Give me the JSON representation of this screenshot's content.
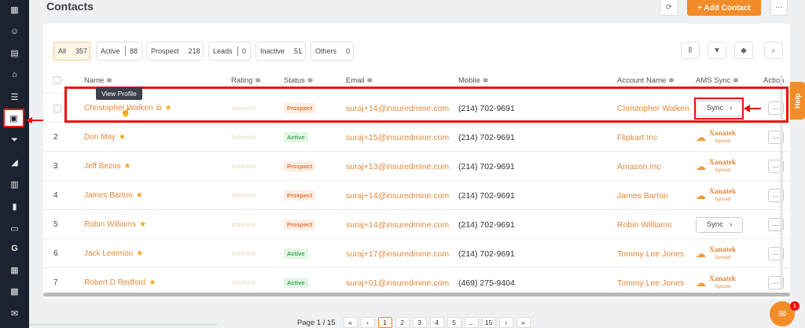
{
  "page": {
    "title": "Contacts"
  },
  "header": {
    "add_contact_label": "+ Add Contact",
    "refresh_icon": "refresh-icon",
    "more_icon": "more-icon"
  },
  "sidebar": {
    "items": [
      "dashboard-icon",
      "contacts-icon",
      "policies-icon",
      "bank-icon",
      "list-icon",
      "contact-card-icon",
      "filter-icon",
      "megaphone-icon",
      "document-icon",
      "reports-icon",
      "folder-icon",
      "google-icon",
      "calculator-icon",
      "calendar-icon",
      "mail-icon"
    ]
  },
  "filters": [
    {
      "label": "All",
      "count": "357"
    },
    {
      "label": "Active",
      "count": "88"
    },
    {
      "label": "Prospect",
      "count": "218"
    },
    {
      "label": "Leads",
      "count": "0"
    },
    {
      "label": "Inactive",
      "count": "51"
    },
    {
      "label": "Others",
      "count": "0"
    }
  ],
  "columns": {
    "name": "Name ≑",
    "rating": "Rating ≑",
    "status": "Status ≑",
    "email": "Email ≑",
    "mobile": "Mobile ≑",
    "account": "Account Name ≑",
    "ams": "AMS Sync ≑",
    "action": "Action"
  },
  "tooltip": "View Profile",
  "help_label": "Help",
  "rating_stars": "☆☆☆☆☆",
  "sync_label": "Sync",
  "xanatek": {
    "brand": "Xanatek",
    "state": "Synced"
  },
  "rows": [
    {
      "num": "",
      "name": "Christopher Walken",
      "status": "Prospect",
      "email": "suraj+14@insuredmine.com",
      "mobile": "(214) 702-9691",
      "account": "Christopher Walken",
      "ams": "sync"
    },
    {
      "num": "2",
      "name": "Don May",
      "status": "Active",
      "email": "suraj+15@insuredmine.com",
      "mobile": "(214) 702-9691",
      "account": "Flipkart Inc",
      "ams": "xanatek"
    },
    {
      "num": "3",
      "name": "Jeff Bezos",
      "status": "Prospect",
      "email": "suraj+13@insuredmine.com",
      "mobile": "(214) 702-9691",
      "account": "Amazon Inc",
      "ams": "xanatek"
    },
    {
      "num": "4",
      "name": "James Barton",
      "status": "Prospect",
      "email": "suraj+14@insuredmine.com",
      "mobile": "(214) 702-9691",
      "account": "James Barton",
      "ams": "xanatek"
    },
    {
      "num": "5",
      "name": "Robin Williams",
      "status": "Prospect",
      "email": "suraj+14@insuredmine.com",
      "mobile": "(214) 702-9691",
      "account": "Robin Williams",
      "ams": "sync"
    },
    {
      "num": "6",
      "name": "Jack Lemmon",
      "status": "Active",
      "email": "suraj+17@insuredmine.com",
      "mobile": "(214) 702-9691",
      "account": "Tommy Lee Jones",
      "ams": "xanatek"
    },
    {
      "num": "7",
      "name": "Robert D Redford",
      "status": "Active",
      "email": "suraj+01@insuredmine.com",
      "mobile": "(469) 275-9404",
      "account": "Tommy Lee Jones",
      "ams": "xanatek"
    }
  ],
  "pagination": {
    "label": "Page 1 / 15",
    "buttons": [
      "«",
      "‹",
      "1",
      "2",
      "3",
      "4",
      "5",
      "...",
      "15",
      "›",
      "»"
    ],
    "current": "1"
  },
  "chat_badge": "1"
}
